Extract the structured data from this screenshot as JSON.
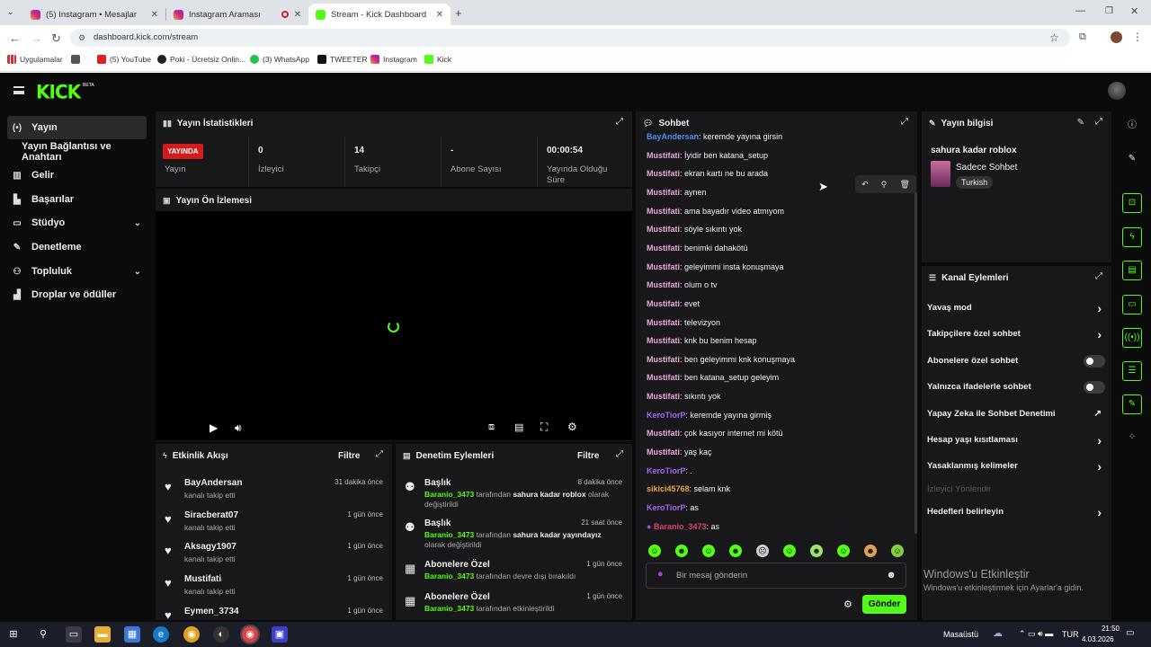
{
  "browser": {
    "tabs": [
      {
        "label": "(5) Instagram • Mesajlar"
      },
      {
        "label": "Instagram Araması"
      },
      {
        "label": "Stream - Kick Dashboard"
      }
    ],
    "url": "dashboard.kick.com/stream",
    "bookmarks": [
      "Uygulamalar",
      "(5) YouTube",
      "Poki - Ücretsiz Onlin...",
      "(3) WhatsApp",
      "TWEETER",
      "Instagram",
      "Kick"
    ]
  },
  "app": {
    "logo": "KICK",
    "beta": "BETA"
  },
  "sidebar": {
    "items": [
      {
        "label": "Yayın",
        "icon": "broadcast-icon"
      },
      {
        "label": "Yayın Bağlantısı ve Anahtarı"
      },
      {
        "label": "Gelir",
        "icon": "bar-chart-icon"
      },
      {
        "label": "Başarılar",
        "icon": "award-icon"
      },
      {
        "label": "Stüdyo",
        "icon": "studio-icon"
      },
      {
        "label": "Denetleme",
        "icon": "wrench-icon"
      },
      {
        "label": "Topluluk",
        "icon": "users-icon"
      },
      {
        "label": "Droplar ve ödüller",
        "icon": "gift-icon"
      }
    ]
  },
  "stats": {
    "title": "Yayın İstatistikleri",
    "live_badge": "YAYINDA",
    "items": [
      {
        "value": "",
        "label": "Yayın"
      },
      {
        "value": "0",
        "label": "İzleyici"
      },
      {
        "value": "14",
        "label": "Takipçi"
      },
      {
        "value": "-",
        "label": "Abone Sayısı"
      },
      {
        "value": "00:00:54",
        "label": "Yayında Olduğu Süre"
      }
    ]
  },
  "preview": {
    "title": "Yayın Ön İzlemesi"
  },
  "activity": {
    "title": "Etkinlik Akışı",
    "filter": "Filtre",
    "items": [
      {
        "name": "BayAndersan",
        "sub": "kanalı takip etti",
        "time": "31 dakika önce"
      },
      {
        "name": "Siracberat07",
        "sub": "kanalı takip etti",
        "time": "1 gün önce"
      },
      {
        "name": "Aksagy1907",
        "sub": "kanalı takip etti",
        "time": "1 gün önce"
      },
      {
        "name": "Mustifati",
        "sub": "kanalı takip etti",
        "time": "1 gün önce"
      },
      {
        "name": "Eymen_3734",
        "sub": "",
        "time": "1 gün önce"
      }
    ]
  },
  "moderation": {
    "title": "Denetim Eylemleri",
    "filter": "Filtre",
    "items": [
      {
        "name": "Başlık",
        "time": "8 dakika önce",
        "user": "Baranio_3473",
        "pre": " tarafından ",
        "bold": "sahura kadar roblox",
        "post": " olarak değiştirildi"
      },
      {
        "name": "Başlık",
        "time": "21 saat önce",
        "user": "Baranio_3473",
        "pre": " tarafından ",
        "bold": "sahura kadar yayındayız",
        "post": " olarak değiştirildi"
      },
      {
        "name": "Abonelere Özel",
        "time": "1 gün önce",
        "user": "Baranio_3473",
        "pre": " tarafından devre dışı bırakıldı",
        "bold": "",
        "post": ""
      },
      {
        "name": "Abonelere Özel",
        "time": "1 gün önce",
        "user": "Baranio_3473",
        "pre": " tarafından etkinleştirildi",
        "bold": "",
        "post": ""
      }
    ]
  },
  "chat": {
    "title": "Sohbet",
    "messages": [
      {
        "user": "BayAndersan",
        "text": ": keremde yayına girsin",
        "color": "#4b8ef0"
      },
      {
        "user": "Mustifati",
        "text": ": İyidir ben katana_setup",
        "color": "#e6a6d6"
      },
      {
        "user": "Mustifati",
        "text": ": ekran kartı ne bu arada",
        "color": "#e6a6d6"
      },
      {
        "user": "Mustifati",
        "text": ": aynen",
        "color": "#e6a6d6"
      },
      {
        "user": "Mustifati",
        "text": ": ama bayadır video atmıyom",
        "color": "#e6a6d6"
      },
      {
        "user": "Mustifati",
        "text": ": söyle sıkıntı yok",
        "color": "#e6a6d6"
      },
      {
        "user": "Mustifati",
        "text": ": benimki dahakötü",
        "color": "#e6a6d6"
      },
      {
        "user": "Mustifati",
        "text": ": geleyimmi insta konuşmaya",
        "color": "#e6a6d6"
      },
      {
        "user": "Mustifati",
        "text": ": olum o tv",
        "color": "#e6a6d6"
      },
      {
        "user": "Mustifati",
        "text": ": evet",
        "color": "#e6a6d6"
      },
      {
        "user": "Mustifati",
        "text": ": televizyon",
        "color": "#e6a6d6"
      },
      {
        "user": "Mustifati",
        "text": ": knk bu benim hesap",
        "color": "#e6a6d6"
      },
      {
        "user": "Mustifati",
        "text": ": ben geleyimmi knk konuşmaya",
        "color": "#e6a6d6"
      },
      {
        "user": "Mustifati",
        "text": ": ben katana_setup geleyim",
        "color": "#e6a6d6"
      },
      {
        "user": "Mustifati",
        "text": ": sıkıntı yok",
        "color": "#e6a6d6"
      },
      {
        "user": "KeroTiorP",
        "text": ": keremde yayına girmiş",
        "color": "#a264f0"
      },
      {
        "user": "Mustifati",
        "text": ": çok kasıyor internet mi kötü",
        "color": "#e6a6d6"
      },
      {
        "user": "Mustifati",
        "text": ": yaş kaç",
        "color": "#e6a6d6"
      },
      {
        "user": "KeroTiorP",
        "text": ": .",
        "color": "#a264f0"
      },
      {
        "user": "sikici45768",
        "text": ": selam knk",
        "color": "#f0a040"
      },
      {
        "user": "KeroTiorP",
        "text": ": as",
        "color": "#a264f0"
      },
      {
        "user": "Baranio_3473",
        "text": ": as",
        "color": "#e04070"
      }
    ],
    "input_placeholder": "Bir mesaj gönderin",
    "send": "Gönder"
  },
  "stream_info": {
    "title": "Yayın bilgisi",
    "stream_title": "sahura kadar roblox",
    "category": "Sadece Sohbet",
    "tag": "Turkish"
  },
  "channel_actions": {
    "title": "Kanal Eylemleri",
    "items": [
      {
        "label": "Yavaş mod",
        "control": "chevron"
      },
      {
        "label": "Takipçilere özel sohbet",
        "control": "chevron"
      },
      {
        "label": "Abonelere özel sohbet",
        "control": "toggle"
      },
      {
        "label": "Yalnızca ifadelerle sohbet",
        "control": "toggle"
      },
      {
        "label": "Yapay Zeka ile Sohbet Denetimi",
        "control": "external"
      },
      {
        "label": "Hesap yaşı kısıtlaması",
        "control": "chevron"
      },
      {
        "label": "Yasaklanmış kelimeler",
        "control": "chevron"
      },
      {
        "label": "İzleyici Yönlendir",
        "control": "none"
      },
      {
        "label": "Hedefleri belirleyin",
        "control": "chevron"
      }
    ]
  },
  "windows": {
    "activate_title": "Windows'u Etkinleştir",
    "activate_sub": "Windows'u etkinleştirmek için Ayarlar'a gidin.",
    "desktop": "Masaüstü",
    "lang": "TUR",
    "time": "21:50",
    "date": "4.03.2026"
  }
}
